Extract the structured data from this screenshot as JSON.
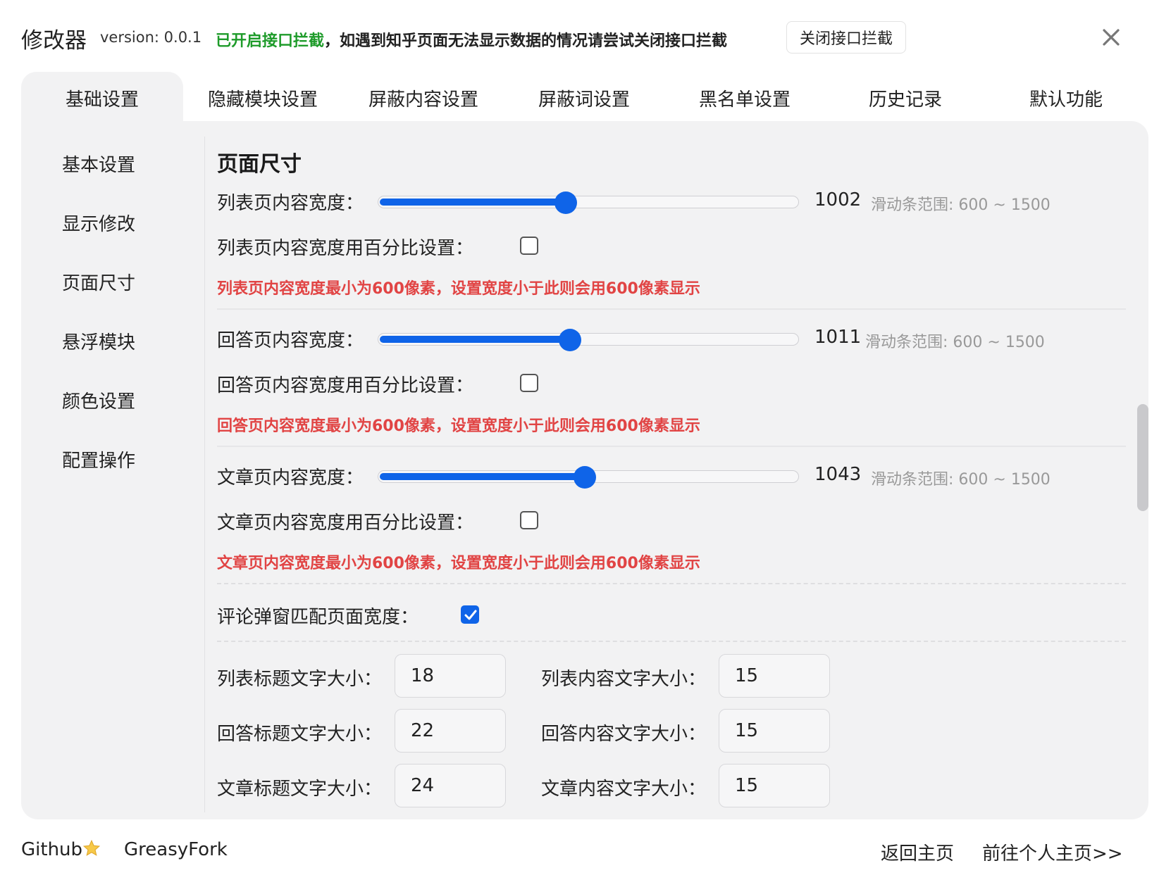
{
  "header": {
    "title": "修改器",
    "version": "version: 0.0.1",
    "notice_on": "已开启接口拦截",
    "notice_rest": "，如遇到知乎页面无法显示数据的情况请尝试关闭接口拦截",
    "close_intercept_label": "关闭接口拦截",
    "close_icon": "close-icon"
  },
  "tabs": [
    {
      "label": "基础设置",
      "active": true
    },
    {
      "label": "隐藏模块设置"
    },
    {
      "label": "屏蔽内容设置"
    },
    {
      "label": "屏蔽词设置"
    },
    {
      "label": "黑名单设置"
    },
    {
      "label": "历史记录"
    },
    {
      "label": "默认功能"
    }
  ],
  "sidebar": {
    "items": [
      {
        "label": "基本设置"
      },
      {
        "label": "显示修改"
      },
      {
        "label": "页面尺寸"
      },
      {
        "label": "悬浮模块"
      },
      {
        "label": "颜色设置"
      },
      {
        "label": "配置操作"
      }
    ]
  },
  "content": {
    "section_title": "页面尺寸",
    "sliders": [
      {
        "label": "列表页内容宽度：",
        "value": "1002",
        "min": 600,
        "max": 1500,
        "range_text": "滑动条范围: 600 ~ 1500",
        "percent_label": "列表页内容宽度用百分比设置：",
        "percent_checked": false,
        "warning": "列表页内容宽度最小为600像素，设置宽度小于此则会用600像素显示"
      },
      {
        "label": "回答页内容宽度：",
        "value": "1011",
        "min": 600,
        "max": 1500,
        "range_text": "滑动条范围: 600 ~ 1500",
        "percent_label": "回答页内容宽度用百分比设置：",
        "percent_checked": false,
        "warning": "回答页内容宽度最小为600像素，设置宽度小于此则会用600像素显示"
      },
      {
        "label": "文章页内容宽度：",
        "value": "1043",
        "min": 600,
        "max": 1500,
        "range_text": "滑动条范围: 600 ~ 1500",
        "percent_label": "文章页内容宽度用百分比设置：",
        "percent_checked": false,
        "warning": "文章页内容宽度最小为600像素，设置宽度小于此则会用600像素显示"
      }
    ],
    "comment_popup": {
      "label": "评论弹窗匹配页面宽度：",
      "checked": true
    },
    "font_sizes": [
      {
        "label": "列表标题文字大小：",
        "value": "18"
      },
      {
        "label": "列表内容文字大小：",
        "value": "15"
      },
      {
        "label": "回答标题文字大小：",
        "value": "22"
      },
      {
        "label": "回答内容文字大小：",
        "value": "15"
      },
      {
        "label": "文章标题文字大小：",
        "value": "24"
      },
      {
        "label": "文章内容文字大小：",
        "value": "15"
      }
    ]
  },
  "footer": {
    "github": "Github",
    "github_icon": "star-icon",
    "greasyfork": "GreasyFork",
    "back_home": "返回主页",
    "personal_page": "前往个人主页>>"
  },
  "colors": {
    "accent": "#0f64e8",
    "notice_green": "#1e9b2a",
    "warning_red": "#e14444",
    "panel_bg": "#f2f2f3"
  }
}
